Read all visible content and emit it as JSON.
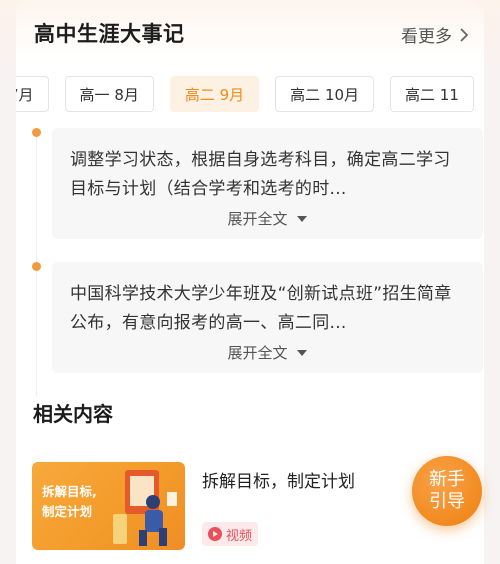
{
  "header": {
    "title": "高中生涯大事记",
    "more_label": "看更多"
  },
  "tabs": [
    {
      "label": "7月",
      "active": false
    },
    {
      "label": "高一 8月",
      "active": false
    },
    {
      "label": "高二 9月",
      "active": true
    },
    {
      "label": "高二 10月",
      "active": false
    },
    {
      "label": "高二 11",
      "active": false
    }
  ],
  "events": [
    {
      "text": "调整学习状态，根据自身选考科目，确定高二学习目标与计划（结合学考和选考的时...",
      "expand_label": "展开全文"
    },
    {
      "text": "中国科学技术大学少年班及“创新试点班”招生简章公布，有意向报考的高一、高二同...",
      "expand_label": "展开全文"
    }
  ],
  "related": {
    "section_title": "相关内容",
    "items": [
      {
        "thumb_line1": "拆解目标,",
        "thumb_line2": "制定计划",
        "title": "拆解目标，制定计划",
        "badge": "视频"
      }
    ]
  },
  "guide": {
    "line1": "新手",
    "line2": "引导"
  },
  "colors": {
    "accent": "#f28b1b",
    "badge_red": "#e8505b"
  }
}
